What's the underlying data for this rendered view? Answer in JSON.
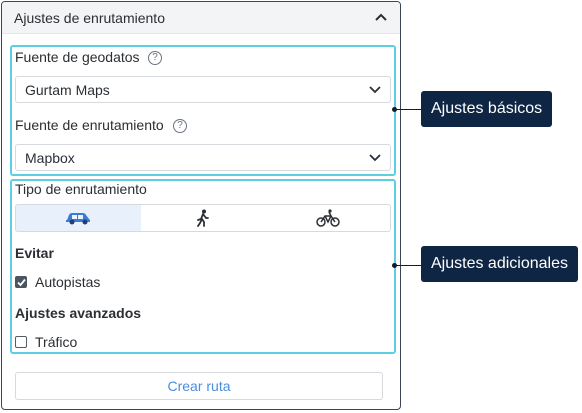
{
  "panel": {
    "title": "Ajustes de enrutamiento",
    "collapse_icon": "chevron-up-icon"
  },
  "basic": {
    "geodata_label": "Fuente de geodatos",
    "geodata_value": "Gurtam Maps",
    "routing_label": "Fuente de enrutamiento",
    "routing_value": "Mapbox",
    "help_icon": "question-icon",
    "help_glyph": "?"
  },
  "additional": {
    "routing_type_label": "Tipo de enrutamiento",
    "modes": [
      {
        "icon": "car-icon",
        "active": true
      },
      {
        "icon": "walking-icon",
        "active": false
      },
      {
        "icon": "bicycle-icon",
        "active": false
      }
    ],
    "avoid_label": "Evitar",
    "highways_label": "Autopistas",
    "highways_checked": true,
    "advanced_label": "Ajustes avanzados",
    "traffic_label": "Tráfico",
    "traffic_checked": false
  },
  "create_button": "Crear ruta",
  "callouts": {
    "basic": "Ajustes básicos",
    "additional": "Ajustes adicionales"
  },
  "colors": {
    "highlight": "#5ccfe0",
    "callout_bg": "#0f2544",
    "active_mode_bg": "#e8f1fb",
    "link_blue": "#4a8ee0",
    "car_blue": "#3a7bd5"
  }
}
